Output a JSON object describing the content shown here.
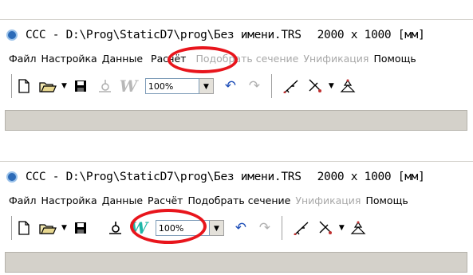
{
  "panels": [
    {
      "window_title": "CCC - D:\\Prog\\StaticD7\\prog\\Без имени.TRS",
      "drawing_size": "2000 x 1000 [мм]",
      "menu": [
        {
          "label": "Файл",
          "enabled": true
        },
        {
          "label": "Настройка",
          "enabled": true
        },
        {
          "label": "Данные",
          "enabled": true
        },
        {
          "label": "Расчёт",
          "enabled": true
        },
        {
          "label": "Подобрать сечение",
          "enabled": false
        },
        {
          "label": "Унификация",
          "enabled": false
        },
        {
          "label": "Помощь",
          "enabled": true
        }
      ],
      "zoom": "100%",
      "tool_states": {
        "check": "disabled",
        "w_tool": "disabled"
      },
      "highlighted": "menu-item-raschyot"
    },
    {
      "window_title": "CCC - D:\\Prog\\StaticD7\\prog\\Без имени.TRS",
      "drawing_size": "2000 x 1000 [мм]",
      "menu": [
        {
          "label": "Файл",
          "enabled": true
        },
        {
          "label": "Настройка",
          "enabled": true
        },
        {
          "label": "Данные",
          "enabled": true
        },
        {
          "label": "Расчёт",
          "enabled": true
        },
        {
          "label": "Подобрать сечение",
          "enabled": true
        },
        {
          "label": "Унификация",
          "enabled": false
        },
        {
          "label": "Помощь",
          "enabled": true
        }
      ],
      "zoom": "100%",
      "tool_states": {
        "check": "enabled",
        "w_tool": "enabled"
      },
      "highlighted": "check-and-w-tools"
    }
  ],
  "icons": {
    "new": "new-file-icon",
    "open": "open-folder-icon",
    "save": "save-disk-icon",
    "check": "check-tool-icon",
    "w_tool": "w-tool-icon",
    "undo": "undo-icon",
    "redo": "redo-icon",
    "draw_line": "draw-line-icon",
    "cut": "cut-icon",
    "structure": "structure-icon"
  },
  "colors": {
    "highlight": "#e8151c",
    "w_enabled": "#1fb7a8",
    "w_disabled": "#b0b0b0",
    "menu_disabled": "#a8a8a8",
    "statusbar": "#d4d1ca"
  }
}
